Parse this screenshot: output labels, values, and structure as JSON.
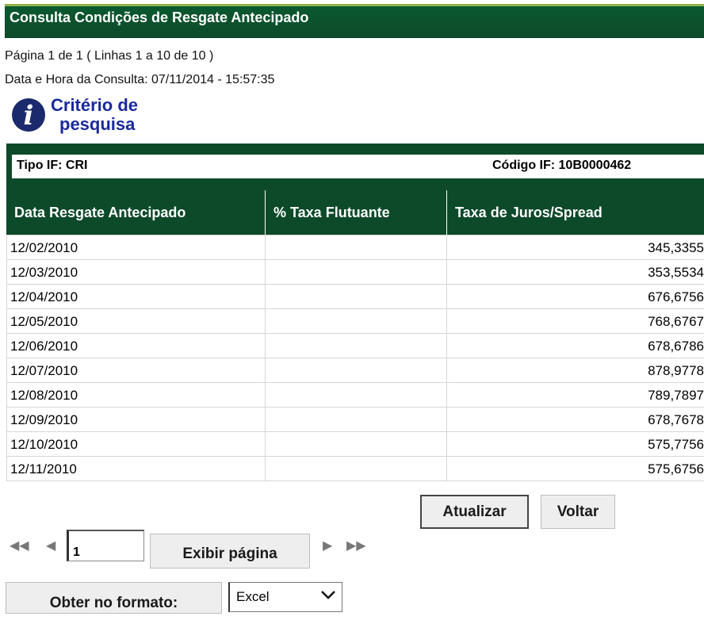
{
  "header": {
    "title": "Consulta Condições de Resgate Antecipado"
  },
  "info": {
    "pagination": "Página 1 de 1 ( Linhas 1 a 10 de 10 )",
    "datetime": "Data e Hora da Consulta: 07/11/2014 - 15:57:35"
  },
  "criteria": {
    "line1": "Critério de",
    "line2": "pesquisa",
    "icon": "info-icon"
  },
  "meta": {
    "tipo_if": "Tipo IF: CRI",
    "codigo_if": "Código IF: 10B0000462"
  },
  "table": {
    "columns": [
      "Data Resgate Antecipado",
      "% Taxa Flutuante",
      "Taxa de Juros/Spread"
    ],
    "rows": [
      [
        "12/02/2010",
        "",
        "345,3355"
      ],
      [
        "12/03/2010",
        "",
        "353,5534"
      ],
      [
        "12/04/2010",
        "",
        "676,6756"
      ],
      [
        "12/05/2010",
        "",
        "768,6767"
      ],
      [
        "12/06/2010",
        "",
        "678,6786"
      ],
      [
        "12/07/2010",
        "",
        "878,9778"
      ],
      [
        "12/08/2010",
        "",
        "789,7897"
      ],
      [
        "12/09/2010",
        "",
        "678,7678"
      ],
      [
        "12/10/2010",
        "",
        "575,7756"
      ],
      [
        "12/11/2010",
        "",
        "575,6756"
      ]
    ]
  },
  "actions": {
    "refresh_label": "Atualizar",
    "back_label": "Voltar"
  },
  "pager": {
    "page_value": "1",
    "show_page_label": "Exibir página"
  },
  "export": {
    "label": "Obter no formato:",
    "format_selected": "Excel"
  }
}
